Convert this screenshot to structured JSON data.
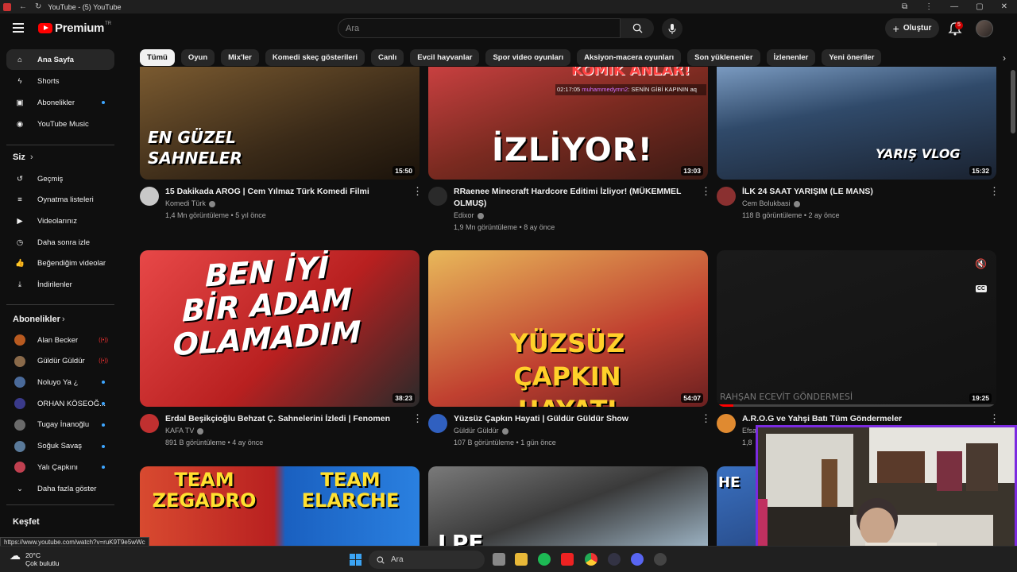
{
  "browser": {
    "tab_title": "YouTube - (5) YouTube"
  },
  "header": {
    "logo_text": "Premium",
    "logo_superscript": "TR",
    "search_placeholder": "Ara",
    "create_label": "Oluştur",
    "notification_count": "5"
  },
  "chips": [
    "Tümü",
    "Oyun",
    "Mix'ler",
    "Komedi skeç gösterileri",
    "Canlı",
    "Evcil hayvanlar",
    "Spor video oyunları",
    "Aksiyon-macera oyunları",
    "Son yüklenenler",
    "İzlenenler",
    "Yeni öneriler"
  ],
  "sidebar": {
    "main": [
      {
        "label": "Ana Sayfa",
        "icon": "home-icon"
      },
      {
        "label": "Shorts",
        "icon": "shorts-icon"
      },
      {
        "label": "Abonelikler",
        "icon": "subscriptions-icon"
      },
      {
        "label": "YouTube Music",
        "icon": "music-icon"
      }
    ],
    "you_heading": "Siz",
    "you": [
      {
        "label": "Geçmiş",
        "icon": "history-icon"
      },
      {
        "label": "Oynatma listeleri",
        "icon": "playlists-icon"
      },
      {
        "label": "Videolarınız",
        "icon": "your-videos-icon"
      },
      {
        "label": "Daha sonra izle",
        "icon": "watch-later-icon"
      },
      {
        "label": "Beğendiğim videolar",
        "icon": "liked-icon"
      },
      {
        "label": "İndirilenler",
        "icon": "downloads-icon"
      }
    ],
    "subs_heading": "Abonelikler",
    "subs": [
      {
        "label": "Alan Becker",
        "color": "#b85a20"
      },
      {
        "label": "Güldür Güldür",
        "color": "#8a6a4a"
      },
      {
        "label": "Noluyo Ya ¿",
        "color": "#4a6a9a"
      },
      {
        "label": "ORHAN KÖSEOĞ...",
        "color": "#3a3a8a"
      },
      {
        "label": "Tugay İnanoğlu",
        "color": "#6a6a6a"
      },
      {
        "label": "Soğuk Savaş",
        "color": "#5a7a9a"
      },
      {
        "label": "Yalı Çapkını",
        "color": "#c04050"
      }
    ],
    "more_label": "Daha fazla göster",
    "explore_heading": "Keşfet"
  },
  "videos": [
    {
      "title": "15 Dakikada AROG | Cem Yılmaz Türk Komedi Filmi",
      "channel": "Komedi Türk",
      "meta": "1,4 Mn görüntüleme • 5 yıl önce",
      "duration": "15:50",
      "overlay": "EN GÜZEL SAHNELER"
    },
    {
      "title": "RRaenee Minecraft Hardcore Editimi İzliyor! (MÜKEMMEL OLMUŞ)",
      "channel": "Edixor",
      "meta": "1,9 Mn görüntüleme • 8 ay önce",
      "duration": "13:03",
      "overlay": "İZLİYOR!",
      "overlay2": "KOMİK ANLAR!",
      "chat_time": "02:17:05",
      "chat_user": "muhammedymn2",
      "chat_text": ": SENİN GİBİ KAPININ aq"
    },
    {
      "title": "İLK 24 SAAT YARIŞIM (LE MANS)",
      "channel": "Cem Bolukbasi",
      "meta": "118 B görüntüleme • 2 ay önce",
      "duration": "15:32",
      "overlay": "YARIŞ VLOG"
    },
    {
      "title": "Erdal Beşikçioğlu Behzat Ç. Sahnelerini İzledi | Fenomen",
      "channel": "KAFA TV",
      "meta": "891 B görüntüleme • 4 ay önce",
      "duration": "38:23",
      "overlay": "BEN İYİ BİR ADAM OLAMADIM"
    },
    {
      "title": "Yüzsüz Çapkın Hayati | Güldür Güldür Show",
      "channel": "Güldür Güldür",
      "meta": "107 B görüntüleme • 1 gün önce",
      "duration": "54:07",
      "overlay": "YÜZSÜZ ÇAPKIN HAYATI"
    },
    {
      "title": "A.R.O.G ve Yahşi Batı Tüm Göndermeler",
      "channel": "Efsa",
      "meta": "1,8",
      "duration": "19:25",
      "overlay": "RAHŞAN ECEVİT GÖNDERMESİ"
    },
    {
      "overlay": "TEAM ZEGADRO",
      "overlay2": "TEAM ELARCHE"
    },
    {
      "overlay": "LPF"
    },
    {
      "overlay": "HE"
    }
  ],
  "status_url": "https://www.youtube.com/watch?v=ruK9T9e5wWc",
  "taskbar": {
    "temp": "20°C",
    "weather": "Çok bulutlu",
    "search": "Ara"
  }
}
